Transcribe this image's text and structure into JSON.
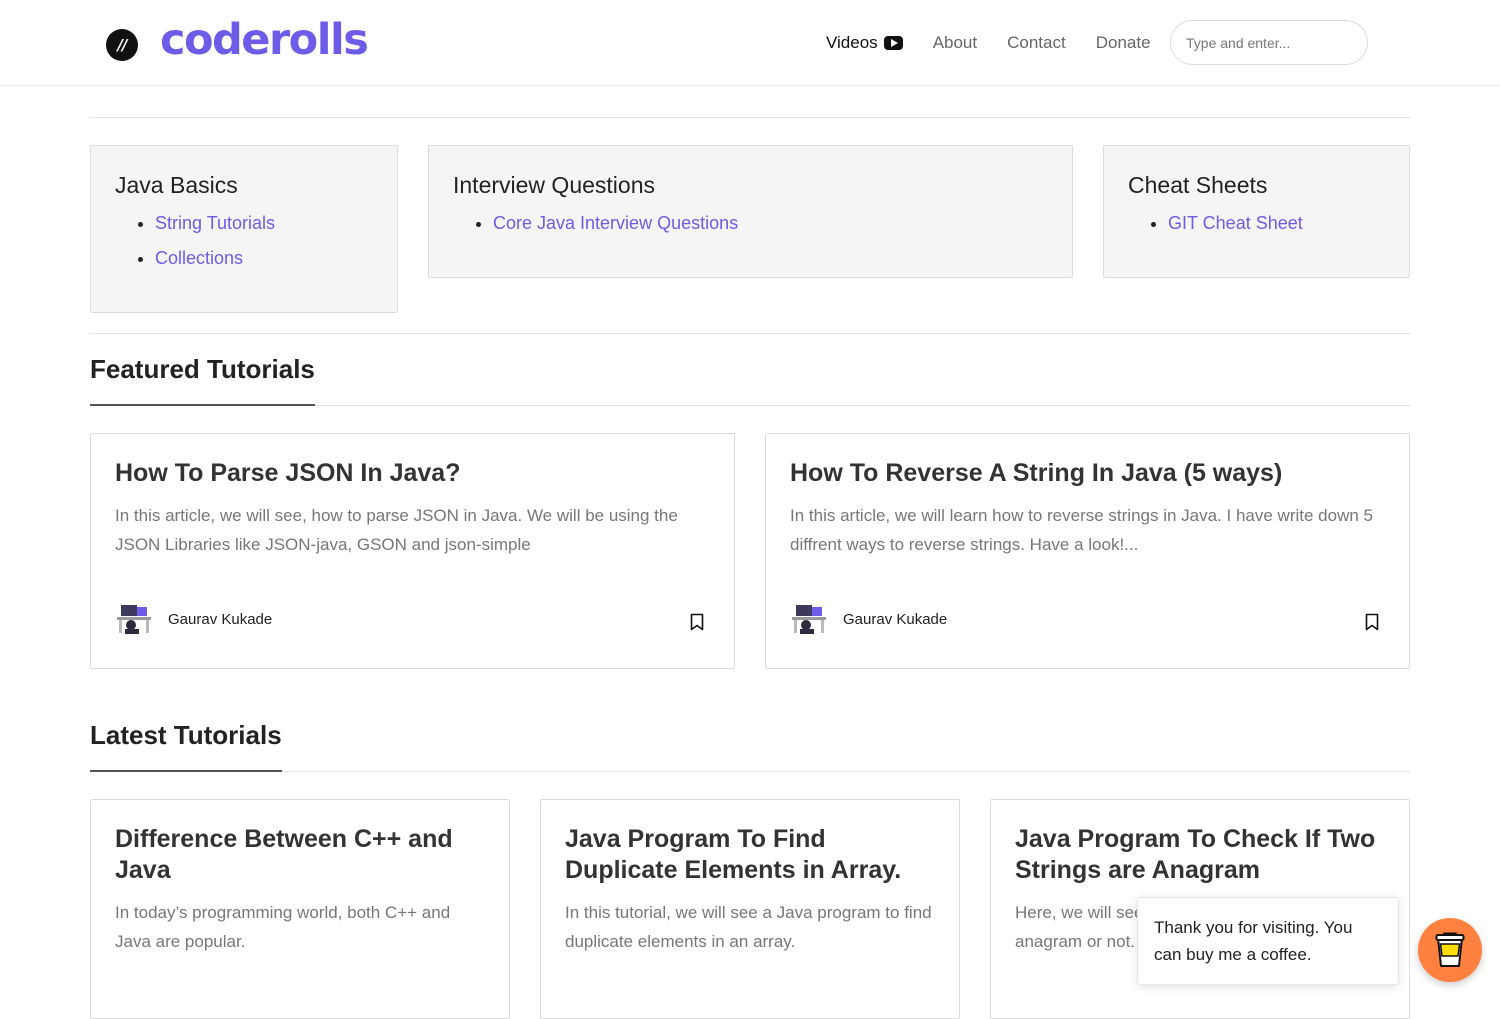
{
  "header": {
    "logo_mark": "//",
    "logo_text": "coderolls",
    "nav": [
      {
        "label": "Videos",
        "icon": "youtube-icon",
        "active": true
      },
      {
        "label": "About"
      },
      {
        "label": "Contact"
      },
      {
        "label": "Donate"
      }
    ],
    "search_placeholder": "Type and enter..."
  },
  "categories": [
    {
      "title": "Java Basics",
      "links": [
        "String Tutorials",
        "Collections"
      ]
    },
    {
      "title": "Interview Questions",
      "links": [
        "Core Java Interview Questions"
      ]
    },
    {
      "title": "Cheat Sheets",
      "links": [
        "GIT Cheat Sheet"
      ]
    }
  ],
  "featured": {
    "heading": "Featured Tutorials",
    "cards": [
      {
        "title": "How To Parse JSON In Java?",
        "description": "In this article, we will see, how to parse JSON in Java. We will be using the JSON Libraries like JSON-java, GSON and json-simple",
        "author": "Gaurav Kukade"
      },
      {
        "title": "How To Reverse A String In Java (5 ways)",
        "description": "In this article, we will learn how to reverse strings in Java. I have write down 5 diffrent ways to reverse strings. Have a look!...",
        "author": "Gaurav Kukade"
      }
    ]
  },
  "latest": {
    "heading": "Latest Tutorials",
    "cards": [
      {
        "title": "Difference Between C++ and Java",
        "description": "In today’s programming world, both C++ and Java are popular."
      },
      {
        "title": "Java Program To Find Duplicate Elements in Array.",
        "description": "In this tutorial, we will see a Java program to find duplicate elements in an array."
      },
      {
        "title": "Java Program To Check If Two Strings are Anagram",
        "description": "Here, we will see whether two strings are anagram or not."
      }
    ]
  },
  "toast": {
    "message": "Thank you for visiting. You can buy me a coffee."
  },
  "colors": {
    "accent": "#6c5ce7",
    "coffee_button": "#ff813f"
  }
}
